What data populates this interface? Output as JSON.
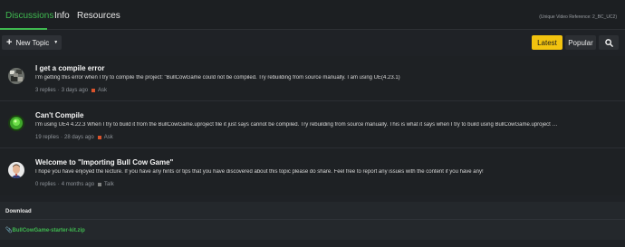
{
  "tabs": [
    {
      "label": "Discussions",
      "active": true
    },
    {
      "label": "Info",
      "active": false
    },
    {
      "label": "Resources",
      "active": false
    }
  ],
  "reference": "(Unique Video Reference: 2_BC_UC2)",
  "toolbar": {
    "new_topic_label": "New Topic",
    "latest_label": "Latest",
    "popular_label": "Popular",
    "search_icon": "search-icon"
  },
  "topics": [
    {
      "title": "I get a compile error",
      "excerpt": "I'm getting this error when I try to compile the project: \"BullCowGame could not be compiled. Try rebuilding from source manually. I am using UE(4.23.1)",
      "replies": "3 replies",
      "age": "3 days ago",
      "category": "Ask",
      "category_color": "#d9532c"
    },
    {
      "title": "Can't Compile",
      "excerpt": "I'm using UE4 4.22.3 When I try to build it from the BullCowGame.uproject file it just says cannot be compiled. Try rebuilding from source manually. This is what it says when I try to build using BullCowGame.uproject …",
      "replies": "19 replies",
      "age": "28 days ago",
      "category": "Ask",
      "category_color": "#d9532c"
    },
    {
      "title": "Welcome to \"Importing Bull Cow Game\"",
      "excerpt": "I hope you have enjoyed the lecture. If you have any hints or tips that you have discovered about this topic please do share. Feel free to report any issues with the content if you have any!",
      "replies": "0 replies",
      "age": "4 months ago",
      "category": "Talk",
      "category_color": "#808281"
    }
  ],
  "download": {
    "title": "Download",
    "link": "BullCowGame-starter-kit.zip"
  },
  "colors": {
    "accent_green": "#3fb950",
    "latest_yellow": "#f2c30f",
    "background": "#1f2226"
  }
}
